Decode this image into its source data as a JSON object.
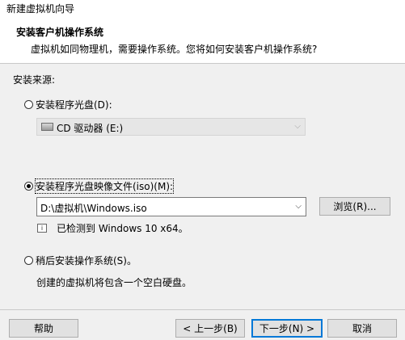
{
  "window": {
    "title": "新建虚拟机向导"
  },
  "header": {
    "title": "安装客户机操作系统",
    "subtitle": "虚拟机如同物理机，需要操作系统。您将如何安装客户机操作系统?"
  },
  "source": {
    "label": "安装来源:",
    "disc_option": {
      "label": "安装程序光盘(D):",
      "selected": false
    },
    "disc_drive": {
      "value": "CD 驱动器 (E:)",
      "icon": "cd-drive-icon",
      "enabled": false
    },
    "iso_option": {
      "label": "安装程序光盘映像文件(iso)(M):",
      "selected": true
    },
    "iso_path": {
      "value": "D:\\虚拟机\\Windows.iso"
    },
    "browse_label": "浏览(R)...",
    "detected": {
      "text": "已检测到 Windows 10 x64。",
      "icon": "info-icon"
    },
    "later_option": {
      "label": "稍后安装操作系统(S)。",
      "selected": false
    },
    "later_hint": "创建的虚拟机将包含一个空白硬盘。"
  },
  "footer": {
    "help": "帮助",
    "back": "< 上一步(B)",
    "next": "下一步(N) >",
    "cancel": "取消"
  }
}
